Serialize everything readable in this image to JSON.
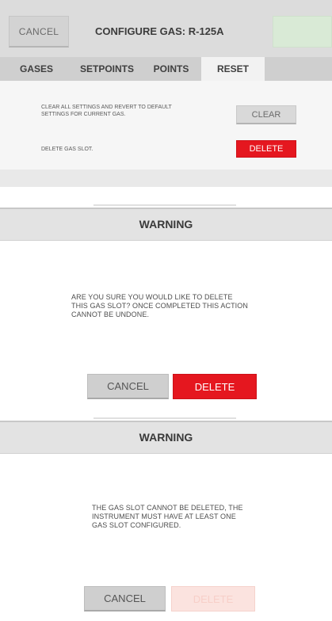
{
  "configure_screen": {
    "cancel_label": "CANCEL",
    "title": "CONFIGURE GAS: R-125A",
    "tabs": [
      {
        "label": "GASES",
        "active": false
      },
      {
        "label": "SETPOINTS",
        "active": false
      },
      {
        "label": "POINTS",
        "active": false
      },
      {
        "label": "RESET",
        "active": true
      }
    ],
    "clear_description_line1": "CLEAR ALL SETTINGS AND REVERT TO DEFAULT",
    "clear_description_line2": "SETTINGS FOR CURRENT GAS.",
    "clear_label": "CLEAR",
    "delete_description": "DELETE GAS SLOT.",
    "delete_label": "DELETE"
  },
  "confirm_dialog": {
    "title": "WARNING",
    "message_line1": "ARE YOU SURE YOU WOULD LIKE TO DELETE",
    "message_line2": "THIS GAS SLOT? ONCE COMPLETED THIS ACTION",
    "message_line3": "CANNOT BE UNDONE.",
    "cancel_label": "CANCEL",
    "delete_label": "DELETE"
  },
  "error_dialog": {
    "title": "WARNING",
    "message_line1": "THE GAS SLOT CANNOT BE DELETED, THE",
    "message_line2": "INSTRUMENT MUST HAVE AT LEAST ONE",
    "message_line3": "GAS SLOT CONFIGURED.",
    "cancel_label": "CANCEL",
    "delete_label": "DELETE"
  },
  "colors": {
    "accent_red": "#e5171f",
    "disabled_red": "#fbe3df",
    "done_green": "#d9ead6",
    "header_gray": "#dcdcdc"
  }
}
